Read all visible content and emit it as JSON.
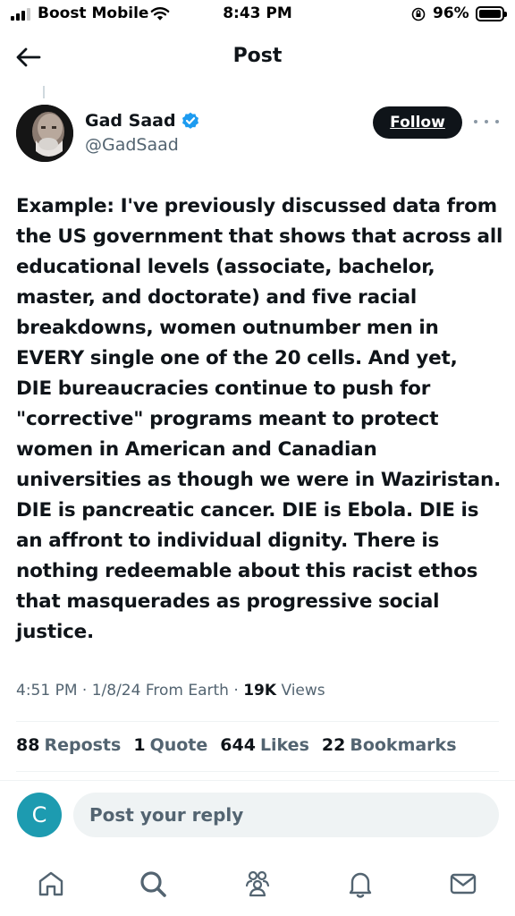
{
  "status_bar": {
    "carrier": "Boost Mobile",
    "time": "8:43 PM",
    "battery": "96%"
  },
  "header": {
    "title": "Post"
  },
  "author": {
    "name": "Gad Saad",
    "handle": "@GadSaad",
    "verified_color": "#1d9bf0"
  },
  "follow_label": "Follow",
  "tweet": {
    "text": "Example: I've previously discussed data from\nthe US government that shows that across all\neducational levels (associate, bachelor,\nmaster, and doctorate) and five racial\nbreakdowns, women outnumber men in\nEVERY single one of the 20 cells.  And yet,\nDIE bureaucracies continue to push for\n\"corrective\" programs meant to protect\nwomen in American and Canadian\nuniversities as though we were in Waziristan.\nDIE is pancreatic cancer.  DIE is Ebola.  DIE is\nan affront to individual dignity.  There is\nnothing redeemable about this racist ethos\nthat masquerades as progressive social\njustice."
  },
  "meta": {
    "time": "4:51 PM",
    "date": "1/8/24",
    "source": "From Earth",
    "views_count": "19K",
    "views_label": "Views"
  },
  "stats": [
    {
      "count": "88",
      "label": "Reposts"
    },
    {
      "count": "1",
      "label": "Quote"
    },
    {
      "count": "644",
      "label": "Likes"
    },
    {
      "count": "22",
      "label": "Bookmarks"
    }
  ],
  "reply": {
    "avatar_letter": "C",
    "placeholder": "Post your reply"
  },
  "tabs": [
    "home-icon",
    "search-icon",
    "communities-icon",
    "notifications-icon",
    "messages-icon"
  ]
}
